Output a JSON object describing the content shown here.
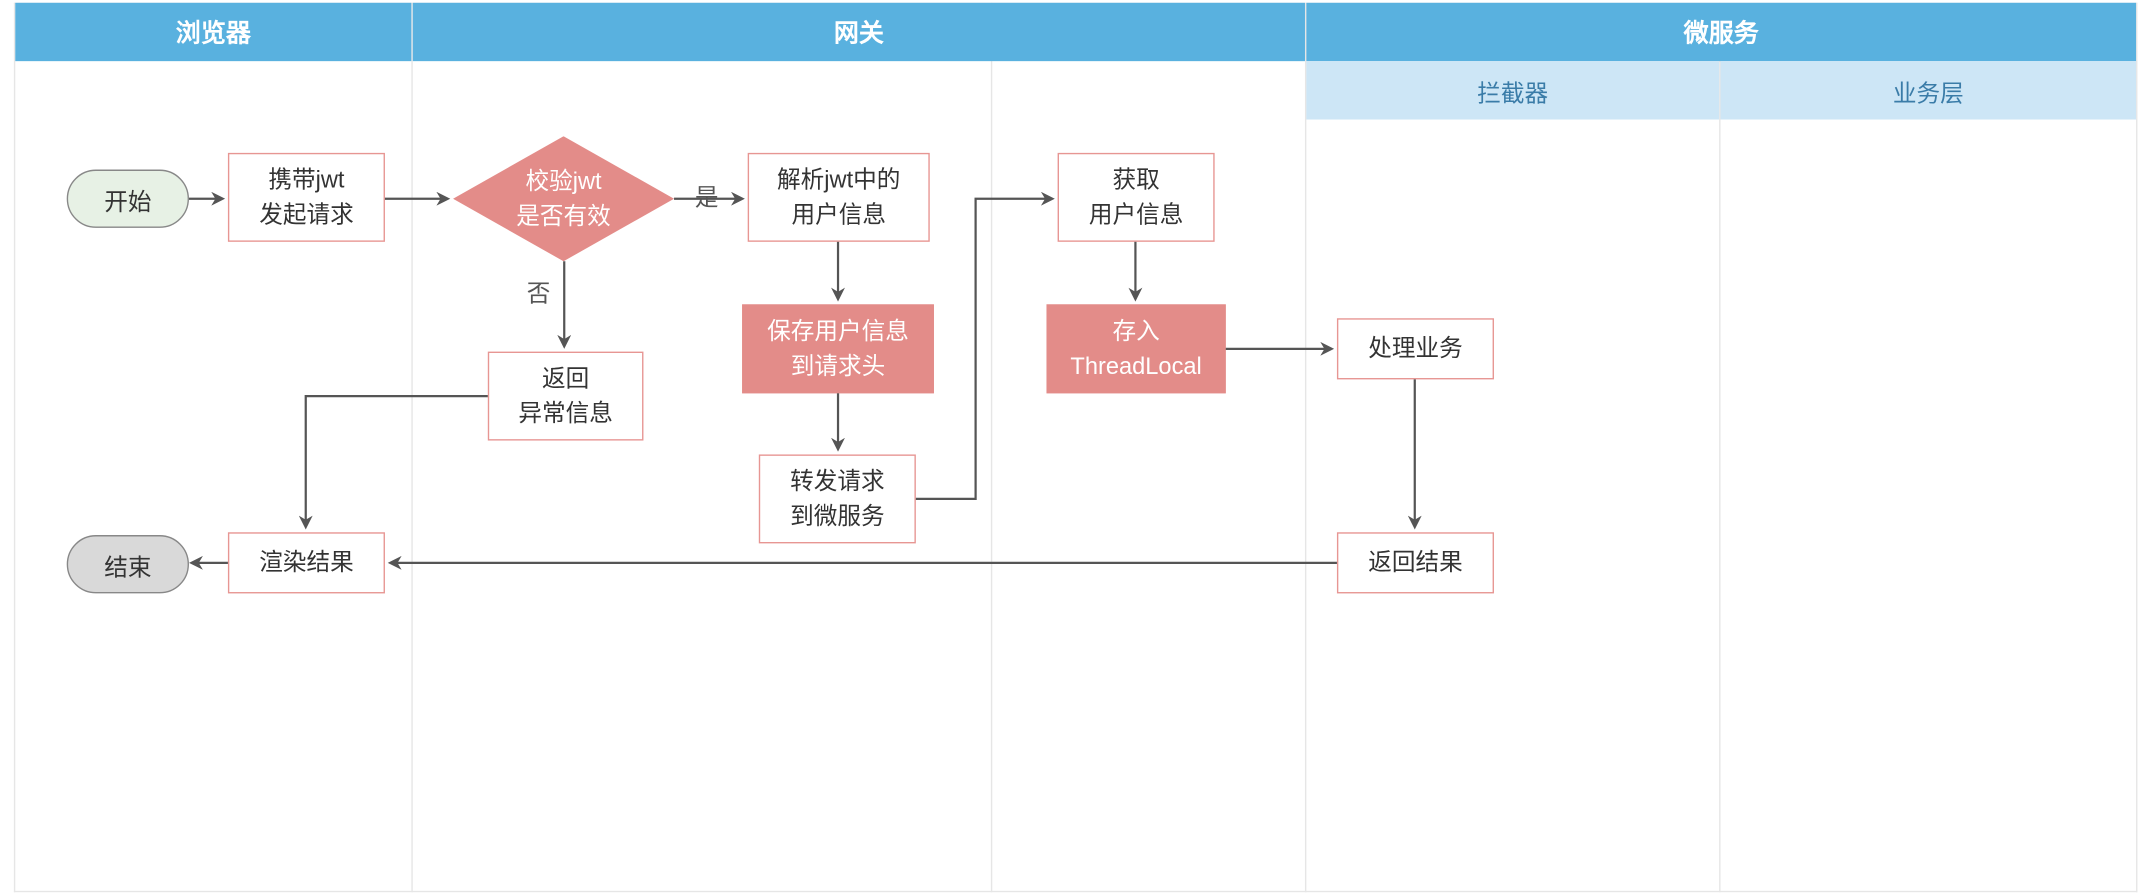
{
  "lanes": {
    "browser": "浏览器",
    "gateway": "网关",
    "microservice": "微服务",
    "interceptor": "拦截器",
    "business": "业务层"
  },
  "nodes": {
    "start": "开始",
    "end": "结束",
    "carry_jwt_l1": "携带jwt",
    "carry_jwt_l2": "发起请求",
    "validate_jwt_l1": "校验jwt",
    "validate_jwt_l2": "是否有效",
    "parse_jwt_l1": "解析jwt中的",
    "parse_jwt_l2": "用户信息",
    "return_error_l1": "返回",
    "return_error_l2": "异常信息",
    "save_header_l1": "保存用户信息",
    "save_header_l2": "到请求头",
    "forward_l1": "转发请求",
    "forward_l2": "到微服务",
    "get_user_l1": "获取",
    "get_user_l2": "用户信息",
    "store_tl_l1": "存入",
    "store_tl_l2": "ThreadLocal",
    "handle_biz": "处理业务",
    "return_result": "返回结果",
    "render_result": "渲染结果"
  },
  "edges": {
    "yes": "是",
    "no": "否"
  },
  "colors": {
    "lane_header": "#59b1df",
    "sub_header": "#cde6f6",
    "node_border": "#e79693",
    "node_fill": "#e38c89",
    "start_fill": "#e7f1e5",
    "end_fill": "#d9d9d9",
    "arrow": "#555555"
  }
}
